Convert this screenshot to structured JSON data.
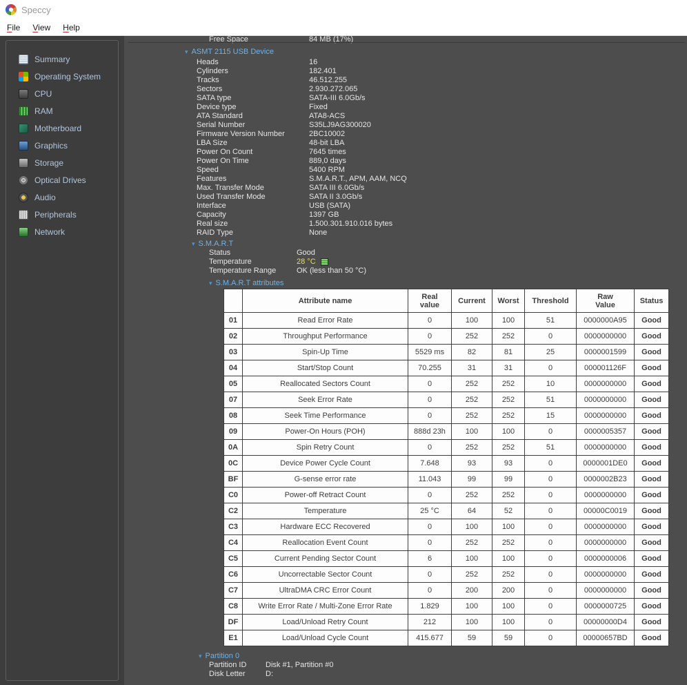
{
  "window": {
    "title": "Speccy"
  },
  "menu": {
    "items": [
      "File",
      "View",
      "Help"
    ]
  },
  "sidebar": {
    "items": [
      {
        "label": "Summary",
        "icon": "summary-icon"
      },
      {
        "label": "Operating System",
        "icon": "os-icon"
      },
      {
        "label": "CPU",
        "icon": "cpu-icon"
      },
      {
        "label": "RAM",
        "icon": "ram-icon"
      },
      {
        "label": "Motherboard",
        "icon": "motherboard-icon"
      },
      {
        "label": "Graphics",
        "icon": "graphics-icon"
      },
      {
        "label": "Storage",
        "icon": "storage-icon"
      },
      {
        "label": "Optical Drives",
        "icon": "optical-drives-icon"
      },
      {
        "label": "Audio",
        "icon": "audio-icon"
      },
      {
        "label": "Peripherals",
        "icon": "peripherals-icon"
      },
      {
        "label": "Network",
        "icon": "network-icon"
      }
    ]
  },
  "content": {
    "top_partial": {
      "label": "Free Space",
      "value": "84 MB (17%)"
    },
    "device": {
      "title": "ASMT 2115 USB Device",
      "rows": [
        {
          "label": "Heads",
          "value": "16"
        },
        {
          "label": "Cylinders",
          "value": "182.401"
        },
        {
          "label": "Tracks",
          "value": "46.512.255"
        },
        {
          "label": "Sectors",
          "value": "2.930.272.065"
        },
        {
          "label": "SATA type",
          "value": "SATA-III 6.0Gb/s"
        },
        {
          "label": "Device type",
          "value": "Fixed"
        },
        {
          "label": "ATA Standard",
          "value": "ATA8-ACS"
        },
        {
          "label": "Serial Number",
          "value": "S35LJ9AG300020"
        },
        {
          "label": "Firmware Version Number",
          "value": "2BC10002"
        },
        {
          "label": "LBA Size",
          "value": "48-bit LBA"
        },
        {
          "label": "Power On Count",
          "value": "7645 times"
        },
        {
          "label": "Power On Time",
          "value": "889,0 days"
        },
        {
          "label": "Speed",
          "value": "5400 RPM"
        },
        {
          "label": "Features",
          "value": "S.M.A.R.T., APM, AAM, NCQ"
        },
        {
          "label": "Max. Transfer Mode",
          "value": "SATA III 6.0Gb/s"
        },
        {
          "label": "Used Transfer Mode",
          "value": "SATA II 3.0Gb/s"
        },
        {
          "label": "Interface",
          "value": "USB (SATA)"
        },
        {
          "label": "Capacity",
          "value": "1397 GB"
        },
        {
          "label": "Real size",
          "value": "1.500.301.910.016 bytes"
        },
        {
          "label": "RAID Type",
          "value": "None"
        }
      ]
    },
    "smart": {
      "title": "S.M.A.R.T",
      "rows": [
        {
          "label": "Status",
          "value": "Good"
        },
        {
          "label": "Temperature",
          "value": "28 °C",
          "color": "#e8df5e",
          "icon": "temperature-graph-icon"
        },
        {
          "label": "Temperature Range",
          "value": "OK (less than 50 °C)"
        }
      ]
    },
    "attributes": {
      "title": "S.M.A.R.T attributes",
      "headers": {
        "id": "",
        "attribute": "Attribute name",
        "real": "Real\nvalue",
        "current": "Current",
        "worst": "Worst",
        "threshold": "Threshold",
        "raw": "Raw\nValue",
        "status": "Status"
      },
      "rows": [
        {
          "id": "01",
          "name": "Read Error Rate",
          "real": "0",
          "current": "100",
          "worst": "100",
          "threshold": "51",
          "raw": "0000000A95",
          "status": "Good"
        },
        {
          "id": "02",
          "name": "Throughput Performance",
          "real": "0",
          "current": "252",
          "worst": "252",
          "threshold": "0",
          "raw": "0000000000",
          "status": "Good"
        },
        {
          "id": "03",
          "name": "Spin-Up Time",
          "real": "5529 ms",
          "current": "82",
          "worst": "81",
          "threshold": "25",
          "raw": "0000001599",
          "status": "Good"
        },
        {
          "id": "04",
          "name": "Start/Stop Count",
          "real": "70.255",
          "current": "31",
          "worst": "31",
          "threshold": "0",
          "raw": "000001126F",
          "status": "Good"
        },
        {
          "id": "05",
          "name": "Reallocated Sectors Count",
          "real": "0",
          "current": "252",
          "worst": "252",
          "threshold": "10",
          "raw": "0000000000",
          "status": "Good"
        },
        {
          "id": "07",
          "name": "Seek Error Rate",
          "real": "0",
          "current": "252",
          "worst": "252",
          "threshold": "51",
          "raw": "0000000000",
          "status": "Good"
        },
        {
          "id": "08",
          "name": "Seek Time Performance",
          "real": "0",
          "current": "252",
          "worst": "252",
          "threshold": "15",
          "raw": "0000000000",
          "status": "Good"
        },
        {
          "id": "09",
          "name": "Power-On Hours (POH)",
          "real": "888d 23h",
          "current": "100",
          "worst": "100",
          "threshold": "0",
          "raw": "0000005357",
          "status": "Good"
        },
        {
          "id": "0A",
          "name": "Spin Retry Count",
          "real": "0",
          "current": "252",
          "worst": "252",
          "threshold": "51",
          "raw": "0000000000",
          "status": "Good"
        },
        {
          "id": "0C",
          "name": "Device Power Cycle Count",
          "real": "7.648",
          "current": "93",
          "worst": "93",
          "threshold": "0",
          "raw": "0000001DE0",
          "status": "Good"
        },
        {
          "id": "BF",
          "name": "G-sense error rate",
          "real": "11.043",
          "current": "99",
          "worst": "99",
          "threshold": "0",
          "raw": "0000002B23",
          "status": "Good"
        },
        {
          "id": "C0",
          "name": "Power-off Retract Count",
          "real": "0",
          "current": "252",
          "worst": "252",
          "threshold": "0",
          "raw": "0000000000",
          "status": "Good"
        },
        {
          "id": "C2",
          "name": "Temperature",
          "real": "25 °C",
          "current": "64",
          "worst": "52",
          "threshold": "0",
          "raw": "00000C0019",
          "status": "Good"
        },
        {
          "id": "C3",
          "name": "Hardware ECC Recovered",
          "real": "0",
          "current": "100",
          "worst": "100",
          "threshold": "0",
          "raw": "0000000000",
          "status": "Good"
        },
        {
          "id": "C4",
          "name": "Reallocation Event Count",
          "real": "0",
          "current": "252",
          "worst": "252",
          "threshold": "0",
          "raw": "0000000000",
          "status": "Good"
        },
        {
          "id": "C5",
          "name": "Current Pending Sector Count",
          "real": "6",
          "current": "100",
          "worst": "100",
          "threshold": "0",
          "raw": "0000000006",
          "status": "Good"
        },
        {
          "id": "C6",
          "name": "Uncorrectable Sector Count",
          "real": "0",
          "current": "252",
          "worst": "252",
          "threshold": "0",
          "raw": "0000000000",
          "status": "Good"
        },
        {
          "id": "C7",
          "name": "UltraDMA CRC Error Count",
          "real": "0",
          "current": "200",
          "worst": "200",
          "threshold": "0",
          "raw": "0000000000",
          "status": "Good"
        },
        {
          "id": "C8",
          "name": "Write Error Rate / Multi-Zone Error Rate",
          "real": "1.829",
          "current": "100",
          "worst": "100",
          "threshold": "0",
          "raw": "0000000725",
          "status": "Good"
        },
        {
          "id": "DF",
          "name": "Load/Unload Retry Count",
          "real": "212",
          "current": "100",
          "worst": "100",
          "threshold": "0",
          "raw": "00000000D4",
          "status": "Good"
        },
        {
          "id": "E1",
          "name": "Load/Unload Cycle Count",
          "real": "415.677",
          "current": "59",
          "worst": "59",
          "threshold": "0",
          "raw": "00000657BD",
          "status": "Good"
        }
      ]
    },
    "partition": {
      "title": "Partition 0",
      "rows": [
        {
          "label": "Partition ID",
          "value": "Disk #1, Partition #0"
        },
        {
          "label": "Disk Letter",
          "value": "D:"
        }
      ]
    }
  },
  "colors": {
    "accent_blue": "#6fb3e5",
    "good_green": "#00b000",
    "temp_yellow": "#e8df5e",
    "sidebar_bg": "#3d3d3d",
    "content_bg": "#4d4d4d"
  }
}
